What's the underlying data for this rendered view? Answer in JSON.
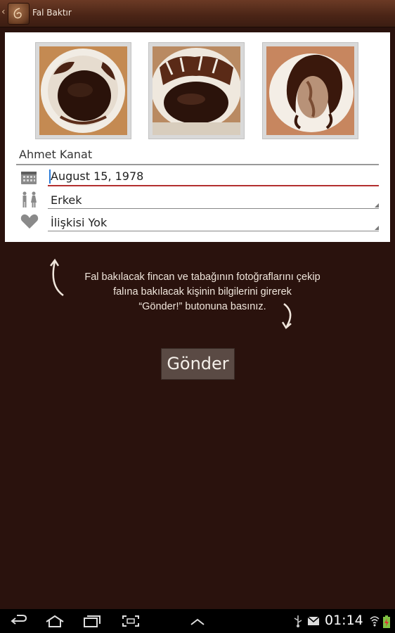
{
  "app": {
    "title": "Fal Baktır"
  },
  "photos": [
    {
      "name": "cup-photo-1"
    },
    {
      "name": "cup-photo-2"
    },
    {
      "name": "saucer-photo"
    }
  ],
  "form": {
    "name_value": "Ahmet Kanat",
    "birthdate_value": "August 15, 1978",
    "gender_value": "Erkek",
    "relationship_value": "İlişkisi Yok"
  },
  "hint": {
    "line1": "Fal bakılacak fincan ve tabağının fotoğraflarını çekip",
    "line2": "falına bakılacak kişinin bilgilerini girerek",
    "line3": "“Gönder!” butonuna basınız."
  },
  "send_button": {
    "label": "Gönder"
  },
  "status_bar": {
    "time": "01:14"
  },
  "colors": {
    "background": "#2a120d",
    "accent_error": "#b32f2f",
    "caret": "#2a7bd8"
  }
}
